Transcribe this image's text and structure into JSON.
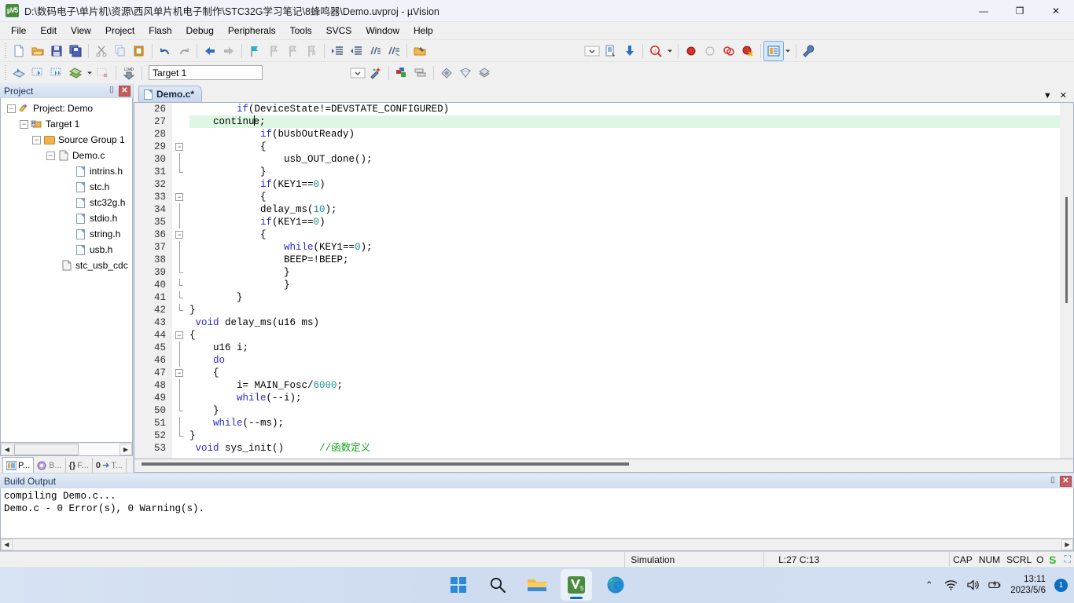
{
  "window": {
    "title": "D:\\数码电子\\单片机\\资源\\西风单片机电子制作\\STC32G学习笔记\\8蜂鸣器\\Demo.uvproj - µVision",
    "app_icon_text": "µV5",
    "minimize": "—",
    "restore": "❐",
    "close": "✕"
  },
  "menu": [
    {
      "label": "File"
    },
    {
      "label": "Edit"
    },
    {
      "label": "View"
    },
    {
      "label": "Project"
    },
    {
      "label": "Flash"
    },
    {
      "label": "Debug"
    },
    {
      "label": "Peripherals"
    },
    {
      "label": "Tools"
    },
    {
      "label": "SVCS"
    },
    {
      "label": "Window"
    },
    {
      "label": "Help"
    }
  ],
  "toolbar_main": [
    {
      "name": "new-file-icon",
      "glyph": "🗋"
    },
    {
      "name": "open-file-icon",
      "glyph": "📂"
    },
    {
      "name": "save-icon",
      "glyph": "💾"
    },
    {
      "name": "save-all-icon",
      "glyph": "🖫"
    },
    {
      "name": "cut-icon",
      "glyph": "✂"
    },
    {
      "name": "copy-icon",
      "glyph": "⧉"
    },
    {
      "name": "paste-icon",
      "glyph": "📋"
    },
    {
      "name": "undo-icon",
      "glyph": "↺"
    },
    {
      "name": "redo-icon",
      "glyph": "↻"
    },
    {
      "name": "navigate-back-icon",
      "glyph": "⬅"
    },
    {
      "name": "navigate-forward-icon",
      "glyph": "➡"
    },
    {
      "name": "bookmark-toggle-icon",
      "glyph": "⚑"
    },
    {
      "name": "bookmark-prev-icon",
      "glyph": "⚐"
    },
    {
      "name": "bookmark-next-icon",
      "glyph": "⚐"
    },
    {
      "name": "bookmark-clear-icon",
      "glyph": "⚐"
    },
    {
      "name": "indent-icon",
      "glyph": "⇥"
    },
    {
      "name": "outdent-icon",
      "glyph": "⇤"
    },
    {
      "name": "comment-icon",
      "glyph": "//"
    },
    {
      "name": "uncomment-icon",
      "glyph": "//"
    },
    {
      "name": "find-in-files-icon",
      "glyph": "🔍"
    }
  ],
  "toolbar_main_right": [
    {
      "name": "configure-toolbar-icon",
      "glyph": "⌄"
    },
    {
      "name": "debug-session-icon",
      "glyph": "▤"
    },
    {
      "name": "start-debug-icon",
      "glyph": "⎙"
    },
    {
      "name": "find-icon",
      "glyph": "🔍"
    },
    {
      "name": "find-dropdown-icon",
      "glyph": "▾"
    },
    {
      "name": "insert-breakpoint-icon",
      "glyph": "●"
    },
    {
      "name": "disable-breakpoint-icon",
      "glyph": "○"
    },
    {
      "name": "disable-all-breakpoints-icon",
      "glyph": "◍"
    },
    {
      "name": "kill-all-breakpoints-icon",
      "glyph": "◉"
    },
    {
      "name": "manage-windows-icon",
      "glyph": "▤"
    },
    {
      "name": "manage-windows-dropdown-icon",
      "glyph": "▾"
    },
    {
      "name": "configure-icon",
      "glyph": "🔧"
    }
  ],
  "toolbar_build": [
    {
      "name": "translate-icon",
      "glyph": "◈"
    },
    {
      "name": "build-icon",
      "glyph": "▥"
    },
    {
      "name": "rebuild-icon",
      "glyph": "▦"
    },
    {
      "name": "batch-build-icon",
      "glyph": "❖"
    },
    {
      "name": "batch-build-dropdown-icon",
      "glyph": "▾"
    },
    {
      "name": "stop-build-icon",
      "glyph": "▧"
    },
    {
      "name": "download-icon",
      "glyph": "⤓"
    }
  ],
  "toolbar_build_right": [
    {
      "name": "select-target-dropdown-icon",
      "glyph": "⌄"
    },
    {
      "name": "target-options-icon",
      "glyph": "✦"
    },
    {
      "name": "manage-project-items-icon",
      "glyph": "▣"
    },
    {
      "name": "manage-multi-project-icon",
      "glyph": "❐"
    },
    {
      "name": "pack-installer-icon",
      "glyph": "◆"
    },
    {
      "name": "select-software-packs-icon",
      "glyph": "◇"
    },
    {
      "name": "manage-run-time-icon",
      "glyph": "◈"
    }
  ],
  "target_select": {
    "label": "Target 1",
    "dropdown_glyph": "⌄"
  },
  "sidebar": {
    "title": "Project",
    "pin_glyph": "⌷",
    "close_glyph": "✕",
    "tree": [
      {
        "label": "Project: Demo",
        "depth": 0,
        "expander": "−",
        "icon": "project-icon"
      },
      {
        "label": "Target 1",
        "depth": 1,
        "expander": "−",
        "icon": "target-icon"
      },
      {
        "label": "Source Group 1",
        "depth": 2,
        "expander": "−",
        "icon": "folder-icon"
      },
      {
        "label": "Demo.c",
        "depth": 3,
        "expander": "−",
        "icon": "source-file-icon"
      },
      {
        "label": "intrins.h",
        "depth": 4,
        "expander": "",
        "icon": "header-file-icon"
      },
      {
        "label": "stc.h",
        "depth": 4,
        "expander": "",
        "icon": "header-file-icon"
      },
      {
        "label": "stc32g.h",
        "depth": 4,
        "expander": "",
        "icon": "header-file-icon"
      },
      {
        "label": "stdio.h",
        "depth": 4,
        "expander": "",
        "icon": "header-file-icon"
      },
      {
        "label": "string.h",
        "depth": 4,
        "expander": "",
        "icon": "header-file-icon"
      },
      {
        "label": "usb.h",
        "depth": 4,
        "expander": "",
        "icon": "header-file-icon"
      },
      {
        "label": "stc_usb_cdc",
        "depth": 3,
        "expander": "",
        "icon": "source-file-icon"
      }
    ],
    "hscroll": {
      "left_glyph": "◀",
      "right_glyph": "▶"
    },
    "tabs": [
      {
        "label": "P...",
        "name": "tab-project",
        "active": true,
        "icon": "project-window-icon"
      },
      {
        "label": "B...",
        "name": "tab-books",
        "active": false,
        "icon": "books-icon"
      },
      {
        "label": "F...",
        "name": "tab-functions",
        "active": false,
        "icon": "functions-icon"
      },
      {
        "label": "T...",
        "name": "tab-templates",
        "active": false,
        "icon": "templates-icon"
      }
    ]
  },
  "editor": {
    "tab": {
      "label": "Demo.c*"
    },
    "tab_controls": {
      "dropdown": "▼",
      "close": "✕"
    },
    "first_line": 26,
    "highlight_line": 27,
    "caret_column": 13,
    "lines": [
      {
        "n": 26,
        "fold": "",
        "html": "        <k>if</k>(DeviceState!=DEVSTATE_CONFIGURED)"
      },
      {
        "n": 27,
        "fold": "",
        "html": "    continu<c></c>e;"
      },
      {
        "n": 28,
        "fold": "",
        "html": "            <k>if</k>(bUsbOutReady)"
      },
      {
        "n": 29,
        "fold": "−",
        "html": "            {"
      },
      {
        "n": 30,
        "fold": "|",
        "html": "                usb_OUT_done();"
      },
      {
        "n": 31,
        "fold": "L",
        "html": "            }"
      },
      {
        "n": 32,
        "fold": "",
        "html": "            <k>if</k>(KEY1==<n>0</n>)"
      },
      {
        "n": 33,
        "fold": "−",
        "html": "            {"
      },
      {
        "n": 34,
        "fold": "|",
        "html": "            delay_ms(<n>10</n>);"
      },
      {
        "n": 35,
        "fold": "|",
        "html": "            <k>if</k>(KEY1==<n>0</n>)"
      },
      {
        "n": 36,
        "fold": "−",
        "html": "            {"
      },
      {
        "n": 37,
        "fold": "|",
        "html": "                <k>while</k>(KEY1==<n>0</n>);"
      },
      {
        "n": 38,
        "fold": "|",
        "html": "                BEEP=!BEEP;"
      },
      {
        "n": 39,
        "fold": "L",
        "html": "                }"
      },
      {
        "n": 40,
        "fold": "L",
        "html": "                }"
      },
      {
        "n": 41,
        "fold": "L",
        "html": "        }"
      },
      {
        "n": 42,
        "fold": "L",
        "html": "}"
      },
      {
        "n": 43,
        "fold": "",
        "html": " <k>void</k> delay_ms(u16 ms)"
      },
      {
        "n": 44,
        "fold": "−",
        "html": "{"
      },
      {
        "n": 45,
        "fold": "|",
        "html": "    u16 i;"
      },
      {
        "n": 46,
        "fold": "|",
        "html": "    <k>do</k>"
      },
      {
        "n": 47,
        "fold": "−",
        "html": "    {"
      },
      {
        "n": 48,
        "fold": "|",
        "html": "        i= MAIN_Fosc/<n>6000</n>;"
      },
      {
        "n": 49,
        "fold": "|",
        "html": "        <k>while</k>(--i);"
      },
      {
        "n": 50,
        "fold": "L",
        "html": "    }"
      },
      {
        "n": 51,
        "fold": "|",
        "html": "    <k>while</k>(--ms);"
      },
      {
        "n": 52,
        "fold": "L",
        "html": "}"
      },
      {
        "n": 53,
        "fold": "",
        "html": " <k>void</k> sys_init()      <m>//函数定义</m>"
      }
    ]
  },
  "build_output": {
    "title": "Build Output",
    "pin_glyph": "⌷",
    "close_glyph": "✕",
    "lines": [
      "compiling Demo.c...",
      "Demo.c - 0 Error(s), 0 Warning(s)."
    ],
    "hscroll_left_glyph": "◀",
    "hscroll_right_glyph": "▶"
  },
  "statusbar": {
    "mode": "Simulation",
    "position": "L:27 C:13",
    "cap": "CAP",
    "num": "NUM",
    "scrl": "SCRL",
    "ovr": "O",
    "ime": "S",
    "ime_tool": "⛶"
  },
  "taskbar": {
    "items": [
      {
        "name": "start-button-icon",
        "label": "Start",
        "active": false
      },
      {
        "name": "search-icon",
        "label": "Search",
        "active": false
      },
      {
        "name": "file-explorer-icon",
        "label": "File Explorer",
        "active": false
      },
      {
        "name": "keil-uvision-icon",
        "label": "µVision",
        "active": true
      },
      {
        "name": "edge-browser-icon",
        "label": "Microsoft Edge",
        "active": false
      }
    ],
    "tray": {
      "chevron": "⌃",
      "wifi": "wifi-icon",
      "volume": "volume-icon",
      "battery": "battery-icon",
      "time": "13:11",
      "date": "2023/5/6",
      "notification_count": "1"
    }
  },
  "colors": {
    "keyword": "#2a2ad0",
    "number": "#1a9090",
    "comment": "#15a015",
    "highlight_line": "#ddf7e2",
    "panel_header": "#cfdcec",
    "accent": "#0b6ec4"
  }
}
